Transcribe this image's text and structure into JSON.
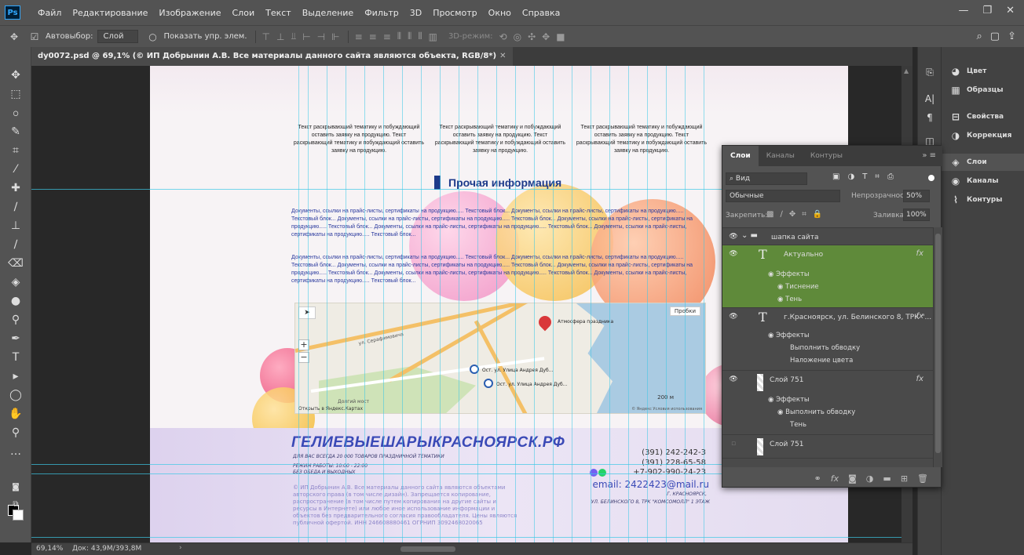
{
  "app": {
    "logo": "Ps"
  },
  "menu": [
    "Файл",
    "Редактирование",
    "Изображение",
    "Слои",
    "Текст",
    "Выделение",
    "Фильтр",
    "3D",
    "Просмотр",
    "Окно",
    "Справка"
  ],
  "window_controls": [
    "—",
    "❐",
    "✕"
  ],
  "options": {
    "autoselect_label": "Автовыбор:",
    "autoselect_target": "Слой",
    "show_controls_label": "Показать упр. элем.",
    "mode3d_label": "3D-режим:"
  },
  "document_tab": {
    "title": "dy0072.psd @ 69,1% (© ИП Добрынин А.В. Все материалы данного сайта являются объекта, RGB/8*)",
    "close": "✕"
  },
  "canvas": {
    "intro_text": "Текст раскрывающий тематику и побуждающий оставить заявку на продукцию. Текст раскрывающий тематику и побуждающий оставить заявку на продукцию.",
    "section_title": "Прочая информация",
    "info_paragraph": "Документы, ссылки на прайс-листы, сертификаты на продукцию..... Текстовый блок... Документы, ссылки на прайс-листы, сертификаты на продукцию..... Текстовый блок... Документы, ссылки на прайс-листы, сертификаты на продукцию..... Текстовый блок... Документы, ссылки на прайс-листы, сертификаты на продукцию..... Текстовый блок... Документы, ссылки на прайс-листы, сертификаты на продукцию..... Текстовый блок... Документы, ссылки на прайс-листы, сертификаты на продукцию..... Текстовый блок...",
    "map": {
      "traffic_label": "Пробки",
      "street_label": "ул. Серафимовича",
      "place_label": "Атмосфера праздника",
      "stop1_label": "Ост. ул. Улица Андрея Дуб...",
      "stop2_label": "Ост. ул. Улица Андрея Дуб...",
      "park_label": "Долгий мост",
      "open_link": "Открыть в Яндекс.Картах",
      "copyright": "© Яндекс Условия использования",
      "scale_label": "200 м",
      "zoom_in": "+",
      "zoom_out": "−"
    },
    "footer": {
      "brand": "ГЕЛИЕВЫЕШАРЫКРАСНОЯРСК.РФ",
      "tagline": "ДЛЯ ВАС ВСЕГДА 20 000 ТОВАРОВ ПРАЗДНИЧНОЙ ТЕМАТИКИ",
      "hours": "РЕЖИМ РАБОТЫ: 10:00 - 22:00",
      "hours_note": "БЕЗ ОБЕДА И ВЫХОДНЫХ",
      "copyright": "© ИП Добрынин А.В. Все материалы данного сайта являются объектами авторского права (в том числе дизайн). Запрещается копирование, распространение (в том числе путем копирования на другие сайты и ресурсы в Интернете) или любое иное использование информации и объектов без предварительного согласия правообладателя. Цены являются публичной офертой. ИНН 246608880461 ОГРНИП 3092468020065",
      "phone1": "(391) 242-242-3",
      "phone2": "(391) 228-65-58",
      "phone3": "+7-902-990-24-23",
      "email": "email: 2422423@mail.ru",
      "city": "Г. КРАСНОЯРСК,",
      "address": "УЛ. БЕЛИНСКОГО 8, ТРК \"КОМСОМОЛЛ\" 1 ЭТАЖ"
    }
  },
  "status": {
    "zoom": "69,14%",
    "doc_size": "Док: 43,9M/393,8M"
  },
  "right_panel": [
    {
      "label": "Цвет",
      "icon": "palette-icon"
    },
    {
      "label": "Образцы",
      "icon": "grid-icon"
    },
    {
      "label": "Свойства",
      "icon": "sliders-icon"
    },
    {
      "label": "Коррекция",
      "icon": "adjust-icon"
    },
    {
      "label": "Слои",
      "icon": "layers-icon"
    },
    {
      "label": "Каналы",
      "icon": "channels-icon"
    },
    {
      "label": "Контуры",
      "icon": "paths-icon"
    }
  ],
  "layers_panel": {
    "tabs": [
      "Слои",
      "Каналы",
      "Контуры"
    ],
    "filter_label": "Вид",
    "blend_mode": "Обычные",
    "opacity_label": "Непрозрачность:",
    "opacity_value": "50%",
    "lock_label": "Закрепить:",
    "fill_label": "Заливка:",
    "fill_value": "100%",
    "group_name": "шапка сайта",
    "layer1_name": "Актуально",
    "layer2_name": "г.Красноярск, ул. Белинского 8, ТРК \"...",
    "layer3_name": "Слой 751",
    "layer4_name": "Слой 751",
    "fx": "fx",
    "effects_label": "Эффекты",
    "emboss": "Тиснение",
    "shadow": "Тень",
    "stroke": "Выполнить обводку",
    "color_overlay": "Наложение цвета",
    "stroke2": "Выполнить обводку",
    "shadow2": "Тень",
    "active_color": "#5f8a3a"
  }
}
